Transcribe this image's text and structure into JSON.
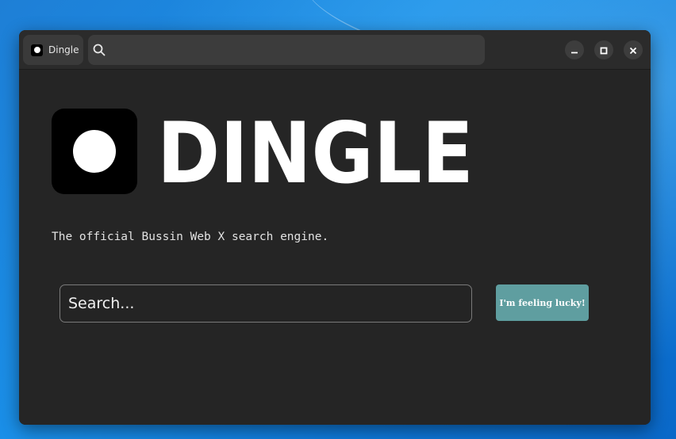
{
  "browser": {
    "tab": {
      "title": "Dingle",
      "icon": "dingle-favicon"
    },
    "urlbar": {
      "value": "",
      "icon": "search-icon"
    },
    "window_controls": [
      "minimize-icon",
      "maximize-icon",
      "close-icon"
    ]
  },
  "page": {
    "logo_text": "DINGLE",
    "tagline": "The official Bussin Web X search engine.",
    "search": {
      "placeholder": "Search...",
      "value": ""
    },
    "lucky_button": {
      "label": "I'm feeling lucky!"
    }
  },
  "colors": {
    "desktop": "#1a8fe8",
    "window_bg": "#252525",
    "titlebar_bg": "#2b2b2b",
    "button_accent": "#5f9ea0",
    "logo_bg": "#000000",
    "text": "#ffffff"
  }
}
